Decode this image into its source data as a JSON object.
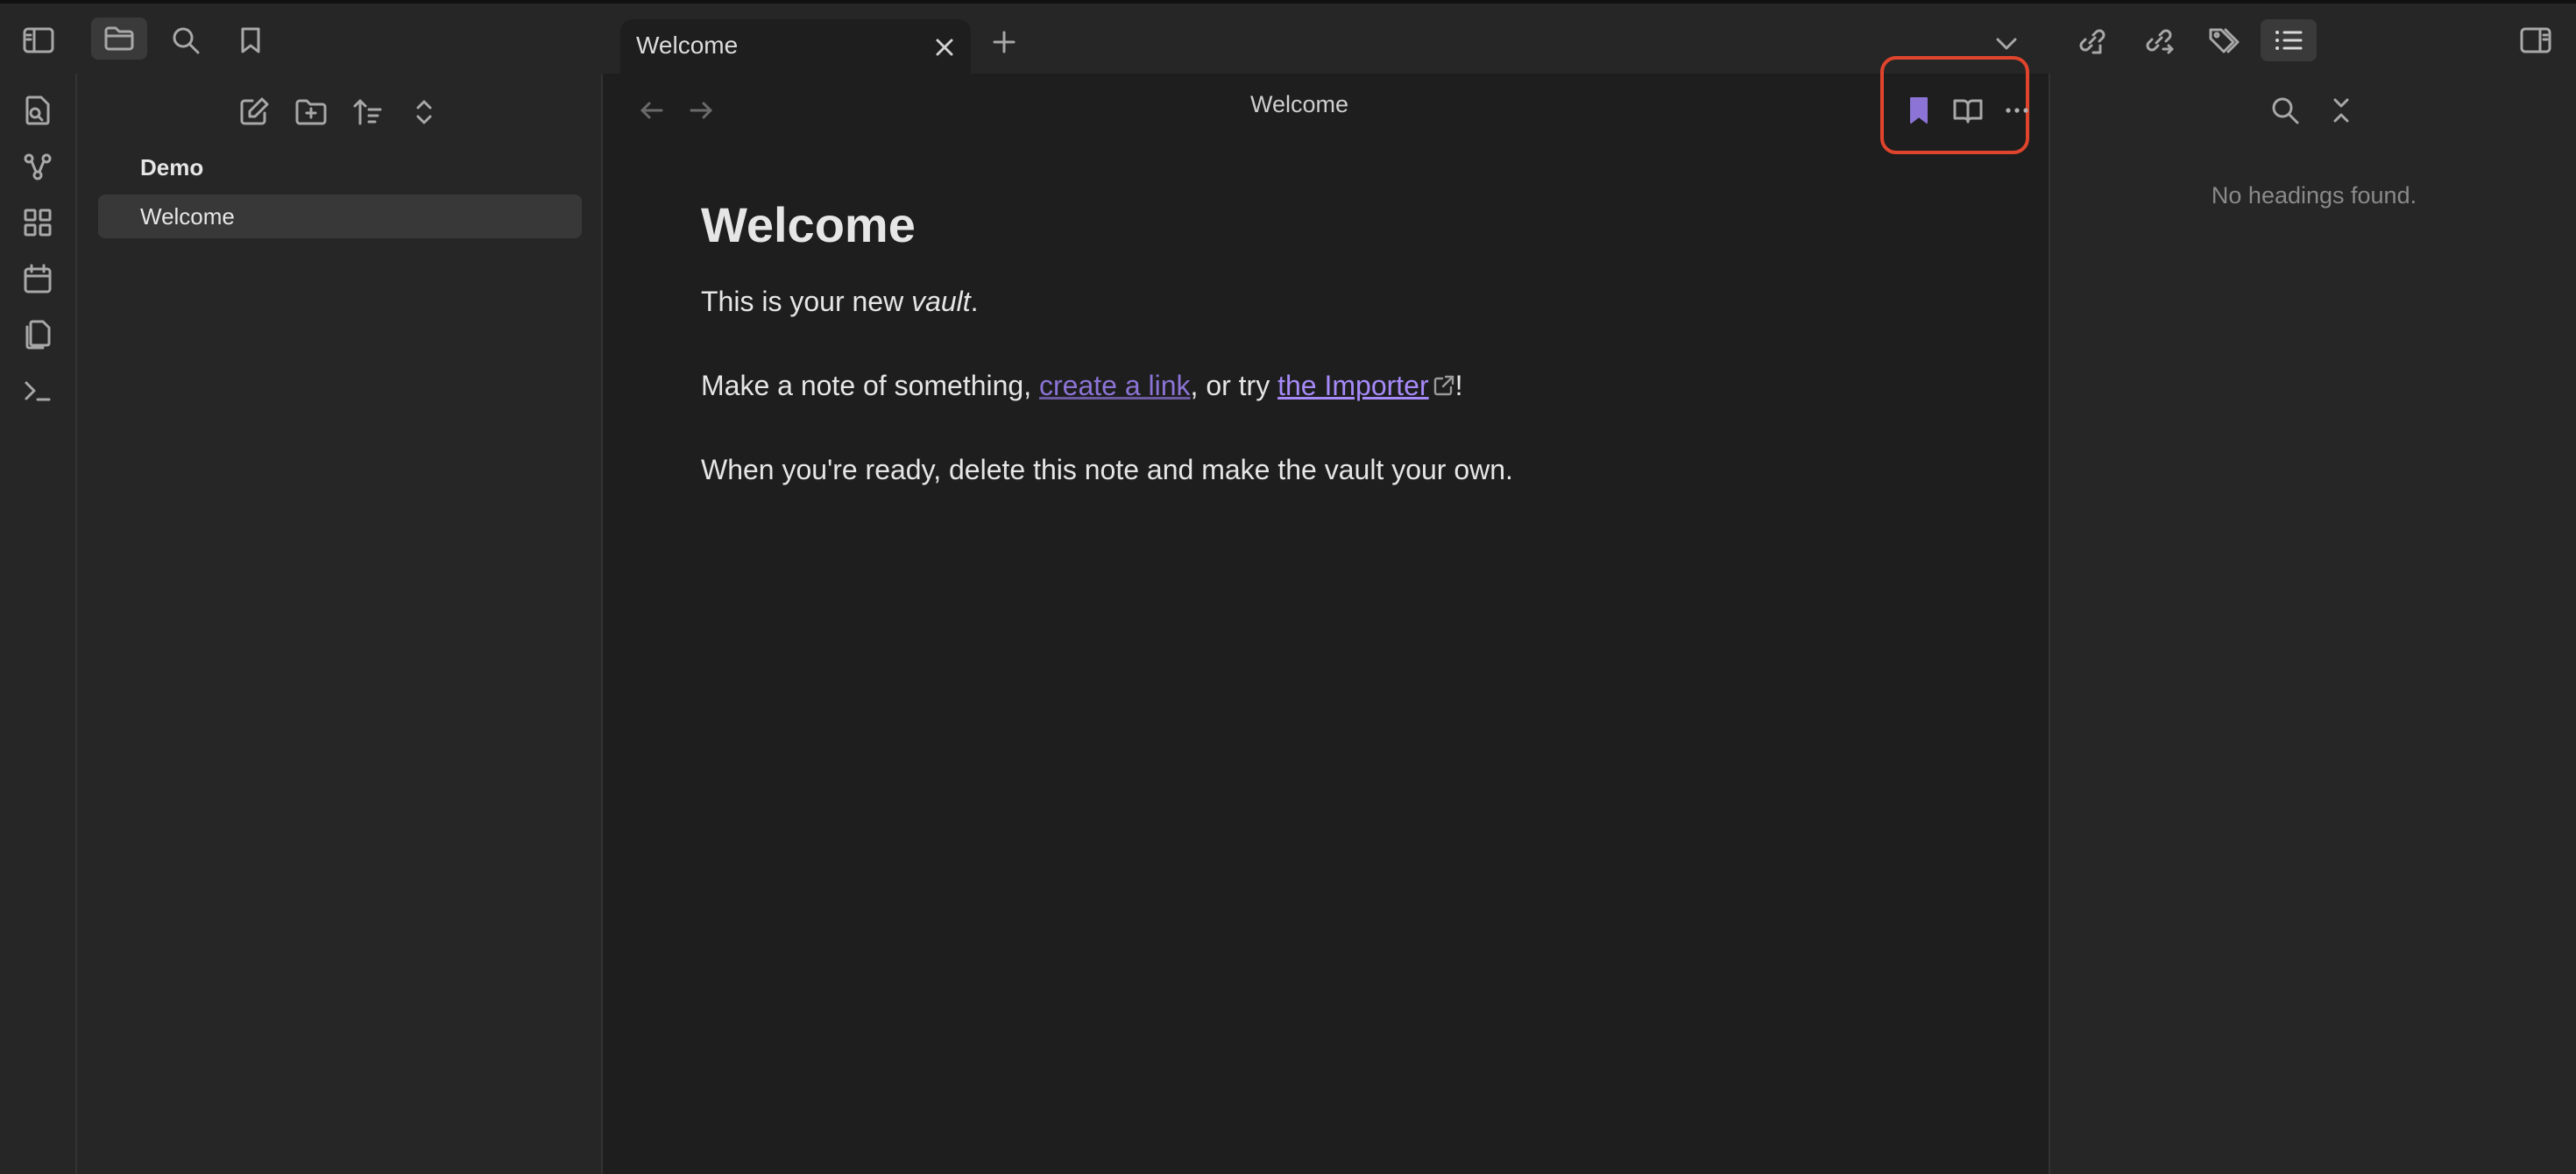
{
  "tabs": [
    {
      "label": "Welcome",
      "active": true
    }
  ],
  "file_explorer": {
    "vault_name": "Demo",
    "files": [
      {
        "label": "Welcome",
        "active": true
      }
    ]
  },
  "view_header": {
    "title": "Welcome",
    "bookmarked": true
  },
  "note": {
    "heading": "Welcome",
    "p1_pre": "This is your new ",
    "p1_em": "vault",
    "p1_post": ".",
    "p2_pre": "Make a note of something, ",
    "p2_link1": "create a link",
    "p2_mid": ", or try ",
    "p2_link2": "the Importer",
    "p2_post": "!",
    "p3": "When you're ready, delete this note and make the vault your own."
  },
  "outline": {
    "empty_text": "No headings found."
  },
  "icons": {
    "ribbon": [
      "quick-switcher-icon",
      "graph-view-icon",
      "canvas-icon",
      "daily-notes-icon",
      "templates-icon",
      "command-palette-icon"
    ],
    "sidebar_tabs": [
      "files-icon",
      "search-icon",
      "bookmarks-icon"
    ],
    "right_tabs": [
      "backlinks-icon",
      "outgoing-links-icon",
      "tags-icon",
      "outline-icon"
    ]
  },
  "colors": {
    "accent": "#8c74d6",
    "highlight_box": "#e0442c",
    "background": "#1e1e1e",
    "sidebar": "#262626"
  }
}
